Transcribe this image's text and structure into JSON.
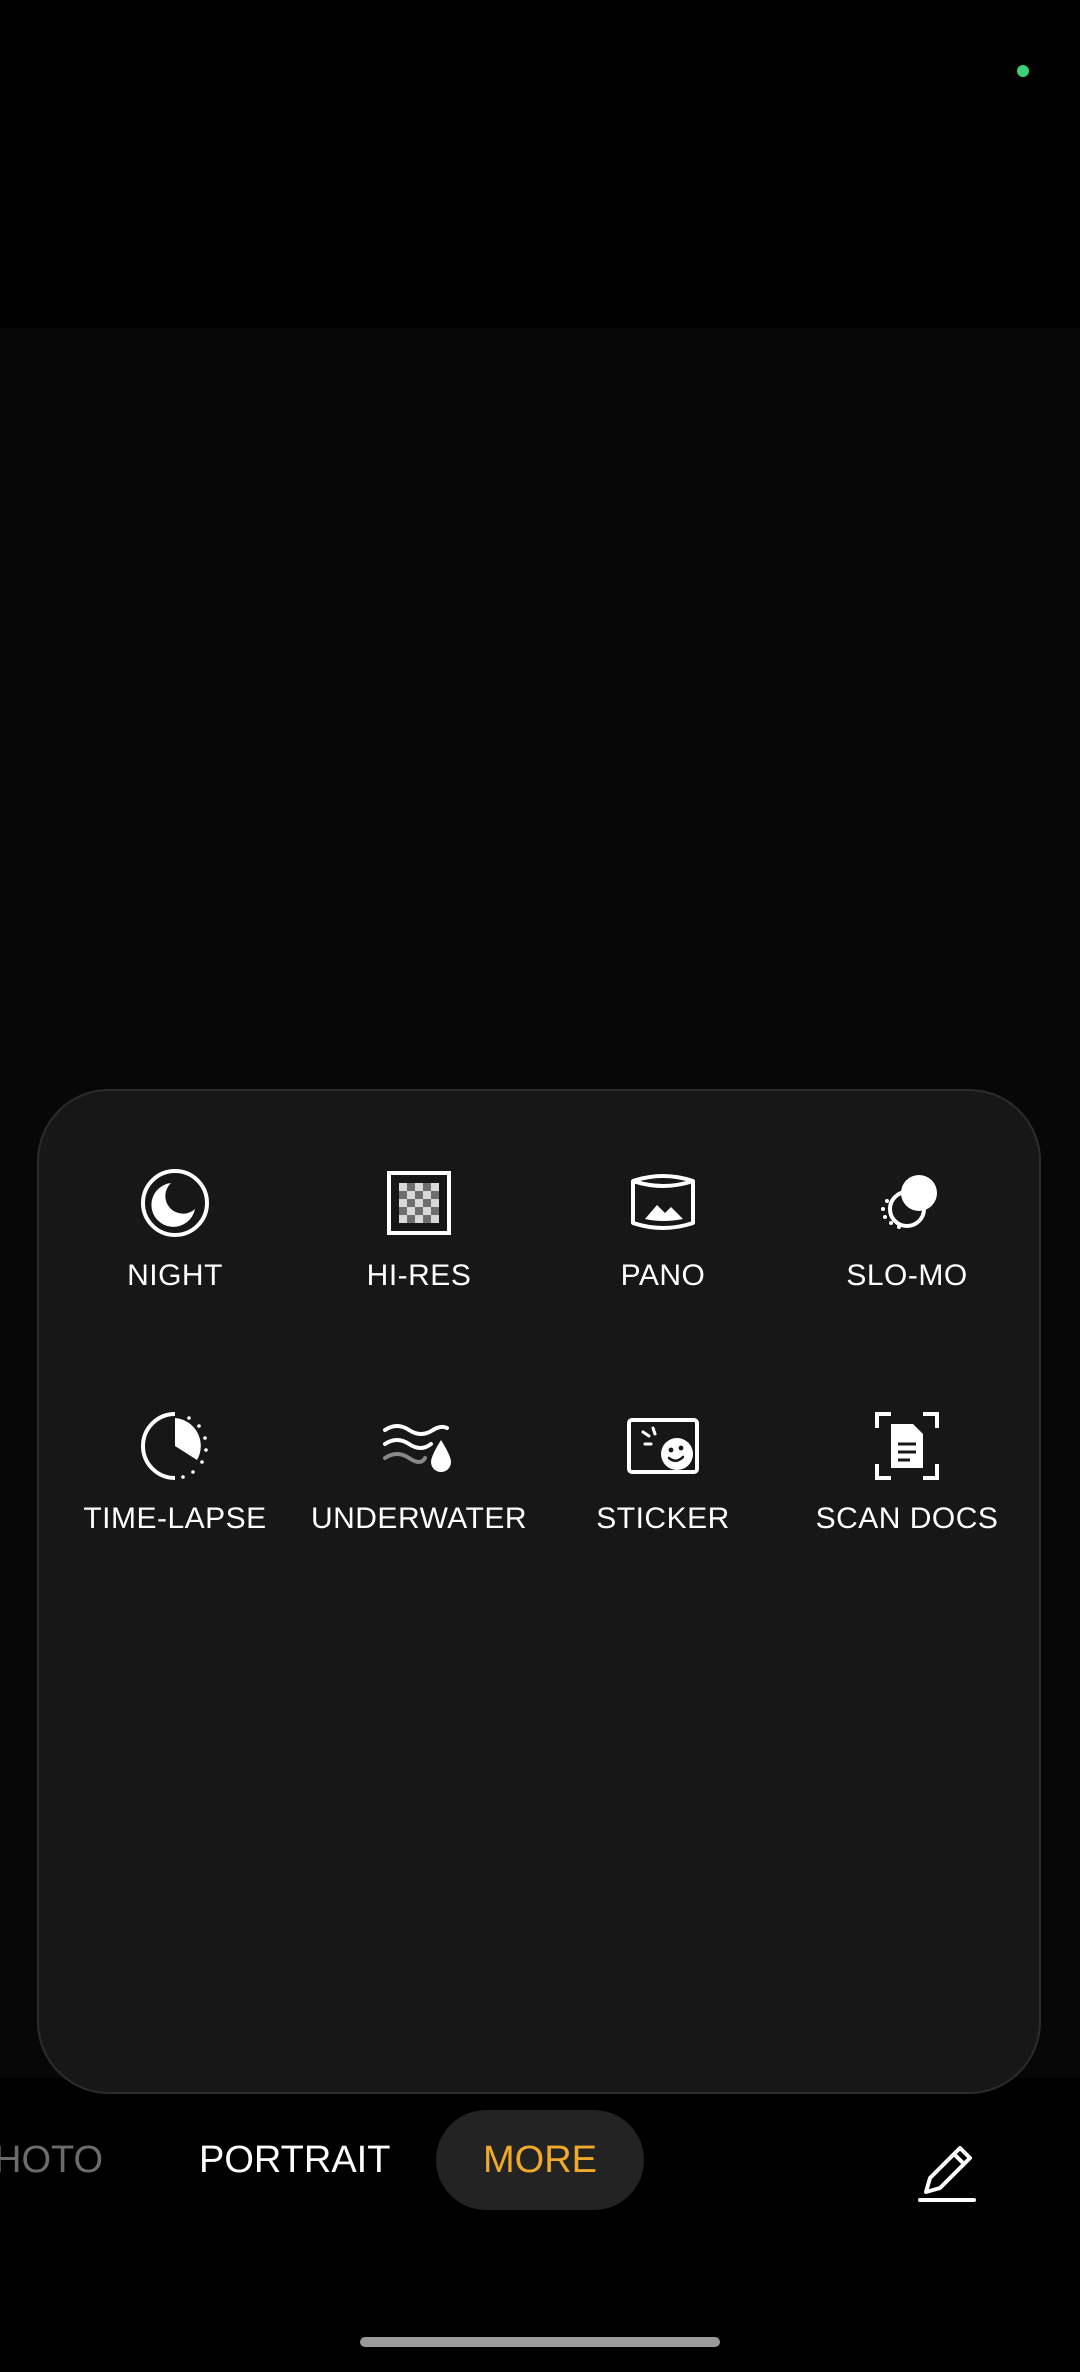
{
  "more_panel": {
    "modes": [
      {
        "label": "NIGHT",
        "icon": "night-moon-icon"
      },
      {
        "label": "HI-RES",
        "icon": "hi-res-grid-icon"
      },
      {
        "label": "PANO",
        "icon": "panorama-icon"
      },
      {
        "label": "SLO-MO",
        "icon": "slow-motion-icon"
      },
      {
        "label": "TIME-LAPSE",
        "icon": "time-lapse-icon"
      },
      {
        "label": "UNDERWATER",
        "icon": "underwater-icon"
      },
      {
        "label": "STICKER",
        "icon": "sticker-icon"
      },
      {
        "label": "SCAN DOCS",
        "icon": "scan-docs-icon"
      }
    ]
  },
  "mode_bar": {
    "photo_label": "HOTO",
    "portrait_label": "PORTRAIT",
    "more_label": "MORE",
    "edit_icon": "pencil-edit-icon"
  },
  "colors": {
    "accent": "#f0a92a",
    "privacy_indicator": "#3ecf7a",
    "panel_background": "#171717"
  }
}
